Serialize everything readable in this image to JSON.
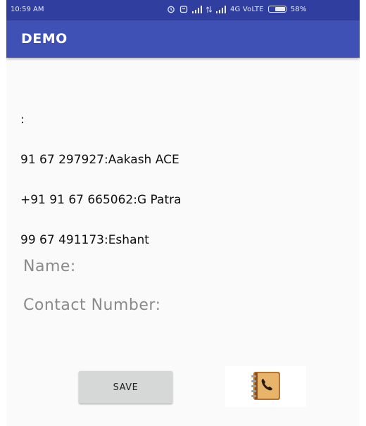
{
  "status_bar": {
    "time": "10:59 AM",
    "network_text": "4G VoLTE",
    "battery_text": "58%",
    "icons": [
      "alarm-icon",
      "timer-icon",
      "signal-icon",
      "data-arrows-icon",
      "signal-icon",
      "battery-icon"
    ]
  },
  "app_bar": {
    "title": "DEMO"
  },
  "contacts": {
    "lines": [
      ":",
      "91 67 297927:Aakash ACE",
      "+91 91 67 665062:G Patra",
      "99 67 491173:Eshant"
    ]
  },
  "form": {
    "name_label": "Name:",
    "contact_label": "Contact Number:"
  },
  "actions": {
    "save_label": "SAVE",
    "contacts_icon": "contacts-book-icon"
  },
  "colors": {
    "status_bar": "#303f9f",
    "app_bar": "#3f51b5",
    "background": "#fafafa",
    "button": "#d6d7d7",
    "label_text": "#8a8a8a"
  }
}
